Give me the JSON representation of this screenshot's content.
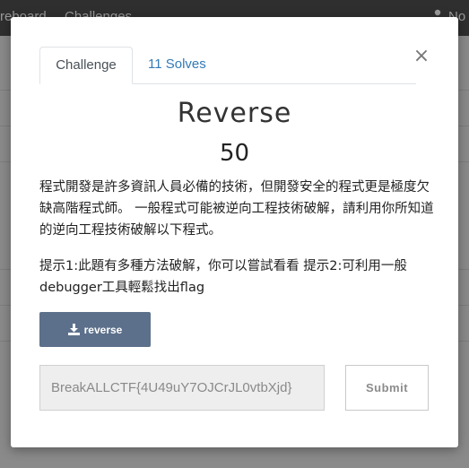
{
  "background": {
    "nav_items": [
      "reboard",
      "Challenges"
    ],
    "user_label": "No"
  },
  "modal": {
    "tabs": [
      {
        "label": "Challenge",
        "active": true
      },
      {
        "label": "11 Solves",
        "active": false
      }
    ],
    "close_symbol": "×",
    "title": "Reverse",
    "value": "50",
    "description": "程式開發是許多資訊人員必備的技術，但開發安全的程式更是極度欠缺高階程式師。 一般程式可能被逆向工程技術破解，請利用你所知道的逆向工程技術破解以下程式。",
    "hint": "提示1:此題有多種方法破解，你可以嘗試看看 提示2:可利用一般debugger工具輕鬆找出flag",
    "file_button_label": "reverse",
    "flag_input_value": "BreakALLCTF{4U49uY7OJCrJL0vtbXjd}",
    "submit_label": "Submit"
  },
  "colors": {
    "button_bg": "#5c708b",
    "link": "#337ab7"
  },
  "icons": {
    "download": "download-icon",
    "close": "close-icon",
    "user": "user-icon"
  }
}
